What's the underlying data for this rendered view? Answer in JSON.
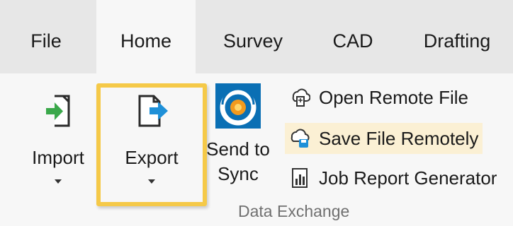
{
  "tabs": [
    {
      "label": "File"
    },
    {
      "label": "Home"
    },
    {
      "label": "Survey"
    },
    {
      "label": "CAD"
    },
    {
      "label": "Drafting"
    }
  ],
  "active_tab": "Home",
  "ribbon": {
    "import": {
      "label": "Import"
    },
    "export": {
      "label": "Export"
    },
    "send_to_sync": {
      "line1": "Send to",
      "line2": "Sync"
    },
    "open_remote_file": {
      "label": "Open Remote File"
    },
    "save_file_remotely": {
      "label": "Save File Remotely"
    },
    "job_report_generator": {
      "label": "Job Report Generator"
    },
    "group_label": "Data Exchange"
  },
  "icons": {
    "import": "import-icon",
    "export": "export-icon",
    "sync": "sync-icon",
    "open_remote": "open-remote-file-icon",
    "save_remote": "save-file-remotely-icon",
    "report": "job-report-icon"
  },
  "colors": {
    "highlight": "#f5c948",
    "import_arrow": "#3aa84a",
    "export_arrow": "#1e90d8",
    "sync_blue": "#0a6fb4",
    "sync_orange": "#f39a1e",
    "hover_bg": "#fbf0d4"
  }
}
